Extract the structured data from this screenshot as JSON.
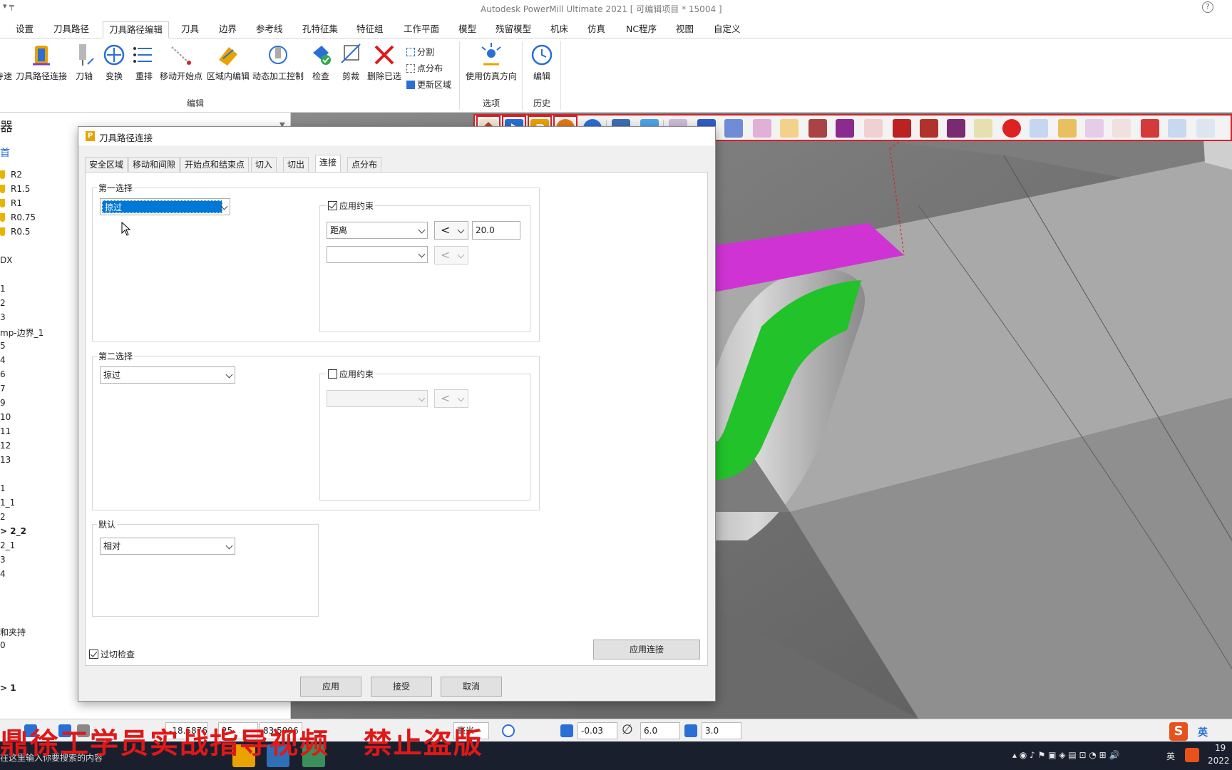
{
  "titlebar": {
    "title": "Autodesk PowerMill Ultimate 2021    [ 可编辑项目 * 15004 ]",
    "quick_access": "▾  ╤",
    "help": "?"
  },
  "menu": {
    "tabs": [
      "设置",
      "刀具路径",
      "刀具路径编辑",
      "刀具",
      "边界",
      "参考线",
      "孔特征集",
      "特征组",
      "工作平面",
      "模型",
      "残留模型",
      "机床",
      "仿真",
      "NC程序",
      "视图",
      "自定义"
    ],
    "active": "刀具路径编辑"
  },
  "ribbon": {
    "buttons": [
      "寺速",
      "刀具路径连接",
      "刀轴",
      "变换",
      "重排",
      "移动开始点",
      "区域内编辑",
      "动态加工控制",
      "检查",
      "剪裁",
      "删除已选"
    ],
    "small_buttons": [
      "分割",
      "点分布",
      "更新区域"
    ],
    "sim_button": "使用仿真方向",
    "history_button": "编辑",
    "group_labels": {
      "edit": "编辑",
      "options": "选项",
      "history": "历史"
    }
  },
  "explorer": {
    "header": "器",
    "header2": "首",
    "tools": [
      "R2",
      "R1.5",
      "R1",
      "R0.75",
      "R0.5"
    ],
    "items": [
      "DX",
      "1",
      "2",
      "3",
      "mp-边界_1",
      "5",
      "4",
      "6",
      "7",
      "9",
      "10",
      "11",
      "12",
      "13",
      "1",
      "1_1",
      "2",
      "> 2_2",
      "2_1",
      "3",
      "4",
      "和夹持",
      "0",
      "> 1"
    ]
  },
  "dialog": {
    "title": "刀具路径连接",
    "tabs": [
      "安全区域",
      "移动和间隙",
      "开始点和结束点",
      "切入",
      "切出",
      "连接",
      "点分布"
    ],
    "active_tab": "连接",
    "first_choice": {
      "legend": "第一选择",
      "value": "掠过",
      "apply_constraint_label": "应用约束",
      "apply_constraint_checked": true,
      "constraint1_field": "距离",
      "constraint1_op": "<",
      "constraint1_value": "20.0",
      "constraint2_field": "",
      "constraint2_op": "<"
    },
    "second_choice": {
      "legend": "第二选择",
      "value": "掠过",
      "apply_constraint_label": "应用约束",
      "apply_constraint_checked": false,
      "constraint_op": "<"
    },
    "default": {
      "legend": "默认",
      "value": "相对"
    },
    "gouge_check_label": "过切检查",
    "gouge_check_checked": true,
    "apply_links_button": "应用连接",
    "buttons": {
      "apply": "应用",
      "accept": "接受",
      "cancel": "取消"
    }
  },
  "statusbar": {
    "f1": "-18.5876",
    "f2": "25",
    "f3": "83.5996",
    "units": "毫米",
    "tol": "-0.03",
    "dia": "6.0",
    "step": "3.0"
  },
  "taskbar": {
    "search_placeholder": "在这里输入你要搜索的内容",
    "ime": "英",
    "ime2": "英",
    "clock_top": "19",
    "clock_bottom": "2022"
  },
  "watermark": "鼎徐工学员实战指导视频   禁止盗版",
  "colors": {
    "accent": "#0078d7",
    "toolpath_green": "#22c22a",
    "toolpath_magenta": "#d033d4",
    "highlight_red": "#d4222a"
  }
}
